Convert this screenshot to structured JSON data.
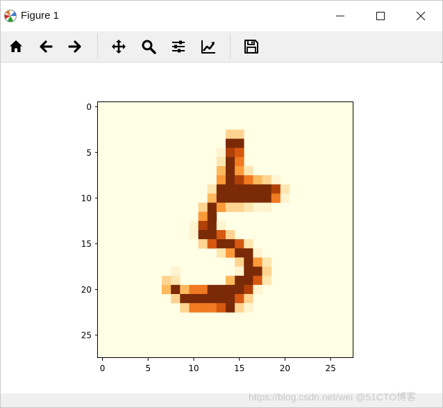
{
  "window": {
    "title": "Figure 1",
    "controls": [
      "minimize-icon",
      "maximize-icon",
      "close-icon"
    ]
  },
  "toolbar": {
    "tools": [
      "home-icon",
      "back-arrow-icon",
      "forward-arrow-icon",
      "pan-icon",
      "zoom-icon",
      "subplots-icon",
      "edit-axes-icon",
      "save-icon"
    ]
  },
  "chart_data": {
    "type": "heatmap",
    "colormap": "Oranges",
    "x_ticks": [
      "0",
      "5",
      "10",
      "15",
      "20",
      "25"
    ],
    "y_ticks": [
      "0",
      "5",
      "10",
      "15",
      "20",
      "25"
    ],
    "xlim": [
      -0.5,
      27.5
    ],
    "ylim": [
      27.5,
      -0.5
    ],
    "grid": false,
    "rows": 28,
    "cols": 28,
    "cells": [
      [
        3,
        14,
        3
      ],
      [
        3,
        15,
        3
      ],
      [
        4,
        14,
        9
      ],
      [
        4,
        15,
        9
      ],
      [
        5,
        13,
        1
      ],
      [
        5,
        14,
        8
      ],
      [
        5,
        15,
        7
      ],
      [
        6,
        13,
        2
      ],
      [
        6,
        14,
        9
      ],
      [
        6,
        15,
        6
      ],
      [
        7,
        13,
        4
      ],
      [
        7,
        14,
        9
      ],
      [
        7,
        15,
        5
      ],
      [
        7,
        16,
        2
      ],
      [
        8,
        13,
        5
      ],
      [
        8,
        14,
        9
      ],
      [
        8,
        15,
        8
      ],
      [
        8,
        16,
        6
      ],
      [
        8,
        17,
        4
      ],
      [
        8,
        18,
        3
      ],
      [
        8,
        19,
        1
      ],
      [
        9,
        12,
        2
      ],
      [
        9,
        13,
        9
      ],
      [
        9,
        14,
        9
      ],
      [
        9,
        15,
        9
      ],
      [
        9,
        16,
        9
      ],
      [
        9,
        17,
        9
      ],
      [
        9,
        18,
        9
      ],
      [
        9,
        19,
        8
      ],
      [
        9,
        20,
        2
      ],
      [
        10,
        12,
        4
      ],
      [
        10,
        13,
        9
      ],
      [
        10,
        14,
        9
      ],
      [
        10,
        15,
        9
      ],
      [
        10,
        16,
        9
      ],
      [
        10,
        17,
        9
      ],
      [
        10,
        18,
        9
      ],
      [
        10,
        19,
        6
      ],
      [
        10,
        20,
        1
      ],
      [
        11,
        11,
        3
      ],
      [
        11,
        12,
        9
      ],
      [
        11,
        13,
        5
      ],
      [
        11,
        14,
        3
      ],
      [
        11,
        15,
        3
      ],
      [
        11,
        16,
        2
      ],
      [
        11,
        17,
        1
      ],
      [
        11,
        18,
        1
      ],
      [
        12,
        11,
        5
      ],
      [
        12,
        12,
        9
      ],
      [
        13,
        10,
        1
      ],
      [
        13,
        11,
        8
      ],
      [
        13,
        12,
        9
      ],
      [
        13,
        13,
        1
      ],
      [
        14,
        10,
        1
      ],
      [
        14,
        11,
        9
      ],
      [
        14,
        12,
        9
      ],
      [
        14,
        13,
        7
      ],
      [
        14,
        14,
        3
      ],
      [
        15,
        11,
        3
      ],
      [
        15,
        12,
        7
      ],
      [
        15,
        13,
        9
      ],
      [
        15,
        14,
        9
      ],
      [
        15,
        15,
        7
      ],
      [
        15,
        16,
        2
      ],
      [
        16,
        13,
        2
      ],
      [
        16,
        14,
        5
      ],
      [
        16,
        15,
        9
      ],
      [
        16,
        16,
        9
      ],
      [
        16,
        17,
        1
      ],
      [
        17,
        15,
        3
      ],
      [
        17,
        16,
        9
      ],
      [
        17,
        17,
        5
      ],
      [
        17,
        18,
        2
      ],
      [
        18,
        8,
        1
      ],
      [
        18,
        15,
        1
      ],
      [
        18,
        16,
        9
      ],
      [
        18,
        17,
        9
      ],
      [
        18,
        18,
        3
      ],
      [
        19,
        7,
        3
      ],
      [
        19,
        8,
        2
      ],
      [
        19,
        14,
        4
      ],
      [
        19,
        15,
        9
      ],
      [
        19,
        16,
        9
      ],
      [
        19,
        17,
        7
      ],
      [
        19,
        18,
        2
      ],
      [
        20,
        7,
        4
      ],
      [
        20,
        8,
        9
      ],
      [
        20,
        9,
        4
      ],
      [
        20,
        10,
        6
      ],
      [
        20,
        11,
        6
      ],
      [
        20,
        12,
        9
      ],
      [
        20,
        13,
        9
      ],
      [
        20,
        14,
        9
      ],
      [
        20,
        15,
        9
      ],
      [
        20,
        16,
        8
      ],
      [
        20,
        17,
        1
      ],
      [
        21,
        8,
        3
      ],
      [
        21,
        9,
        9
      ],
      [
        21,
        10,
        9
      ],
      [
        21,
        11,
        9
      ],
      [
        21,
        12,
        9
      ],
      [
        21,
        13,
        9
      ],
      [
        21,
        14,
        9
      ],
      [
        21,
        15,
        7
      ],
      [
        21,
        16,
        3
      ],
      [
        22,
        9,
        3
      ],
      [
        22,
        10,
        6
      ],
      [
        22,
        11,
        6
      ],
      [
        22,
        12,
        6
      ],
      [
        22,
        13,
        7
      ],
      [
        22,
        14,
        9
      ],
      [
        22,
        15,
        3
      ],
      [
        22,
        16,
        1
      ]
    ],
    "scale": [
      "#ffffe5",
      "#fff3d0",
      "#fee6b0",
      "#fed490",
      "#fdb95e",
      "#fb9a39",
      "#f07921",
      "#d75810",
      "#b04008",
      "#7a2a06"
    ]
  },
  "watermark": "https://blog.csdn.net/wei @51CTO博客"
}
